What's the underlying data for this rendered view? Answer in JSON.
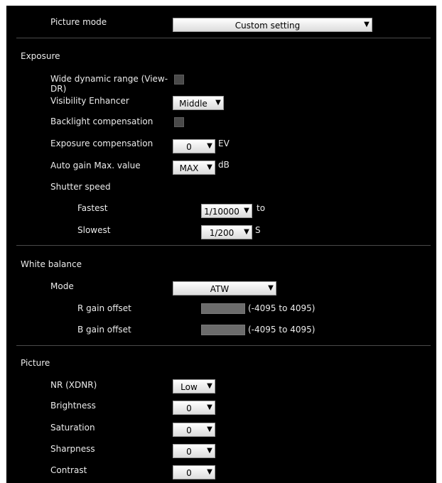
{
  "picture_mode": {
    "label": "Picture mode",
    "value": "Custom setting"
  },
  "exposure": {
    "heading": "Exposure",
    "wdr_label": "Wide dynamic range (View-DR)",
    "visibility_label": "Visibility Enhancer",
    "visibility_value": "Middle",
    "backlight_label": "Backlight compensation",
    "comp_label": "Exposure compensation",
    "comp_value": "0",
    "comp_unit": "EV",
    "gain_label": "Auto gain Max. value",
    "gain_value": "MAX",
    "gain_unit": "dB",
    "shutter_label": "Shutter speed",
    "fastest_label": "Fastest",
    "fastest_value": "1/10000",
    "fastest_unit": "to",
    "slowest_label": "Slowest",
    "slowest_value": "1/200",
    "slowest_unit": "S"
  },
  "white_balance": {
    "heading": "White balance",
    "mode_label": "Mode",
    "mode_value": "ATW",
    "r_label": "R gain offset",
    "r_range": "(-4095 to 4095)",
    "b_label": "B gain offset",
    "b_range": "(-4095 to 4095)"
  },
  "picture": {
    "heading": "Picture",
    "nr_label": "NR (XDNR)",
    "nr_value": "Low",
    "brightness_label": "Brightness",
    "brightness_value": "0",
    "saturation_label": "Saturation",
    "saturation_value": "0",
    "sharpness_label": "Sharpness",
    "sharpness_value": "0",
    "contrast_label": "Contrast",
    "contrast_value": "0"
  },
  "icons": {
    "dropdown_arrow": "▼"
  }
}
